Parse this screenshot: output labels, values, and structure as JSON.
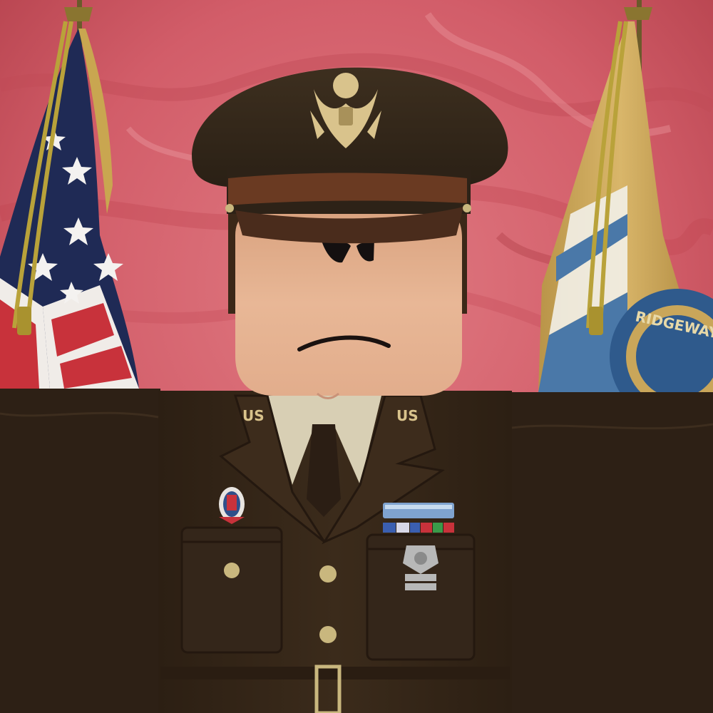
{
  "scene": {
    "colors": {
      "backdrop": "#d96670",
      "backdrop_dark": "#b8434f",
      "uniform": "#3a2a1b",
      "uniform_dark": "#2b1e12",
      "cap": "#35281a",
      "cap_band": "#6a3a22",
      "skin": "#e8b796",
      "shirt": "#d8cfb4",
      "insignia_gold": "#d9c38c",
      "flag_red": "#c8323b",
      "flag_blue": "#1f2a55",
      "county_gold": "#c9a65a",
      "county_blue": "#4a78a8"
    }
  },
  "flags": {
    "left": {
      "name": "United States flag"
    },
    "right": {
      "name": "county flag",
      "seal_text": "RIDGEWAY CO"
    }
  },
  "character": {
    "cap": {
      "emblem": "eagle-emblem"
    },
    "lapel_left": "US",
    "lapel_right": "US",
    "badge_left": "unit-crest-icon",
    "badge_right": "marksmanship-badge-icon",
    "ribbons": "ribbon-bar"
  }
}
